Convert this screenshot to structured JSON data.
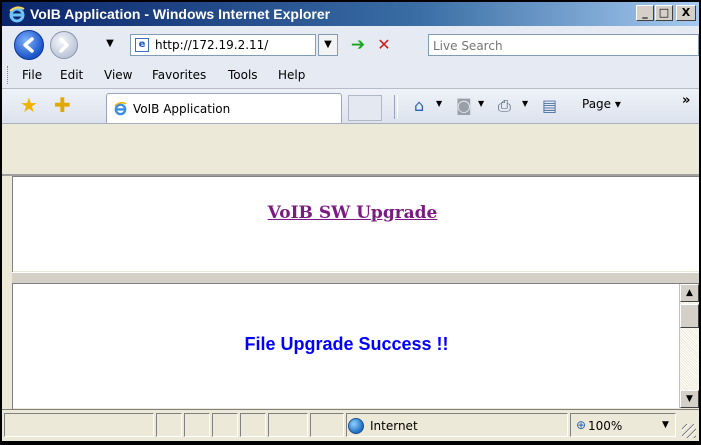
{
  "window": {
    "title": "VoIB Application - Windows Internet Explorer",
    "minimize": "_",
    "maximize": "□",
    "close": "X"
  },
  "address": {
    "url": "http://172.19.2.11/",
    "search_placeholder": "Live Search"
  },
  "menu": {
    "items": [
      {
        "label": "File"
      },
      {
        "label": "Edit"
      },
      {
        "label": "View"
      },
      {
        "label": "Favorites"
      },
      {
        "label": "Tools"
      },
      {
        "label": "Help"
      }
    ]
  },
  "tabs": {
    "active_label": "VoIB Application",
    "page_label": "Page",
    "more": "»"
  },
  "content": {
    "top_link": "VoIB SW Upgrade",
    "message": "File Upgrade Success !!"
  },
  "status": {
    "zone": "Internet",
    "zoom": "100%"
  },
  "colors": {
    "link": "#7b1a83",
    "message": "#0000ff",
    "titlebar": "#0a246a"
  }
}
